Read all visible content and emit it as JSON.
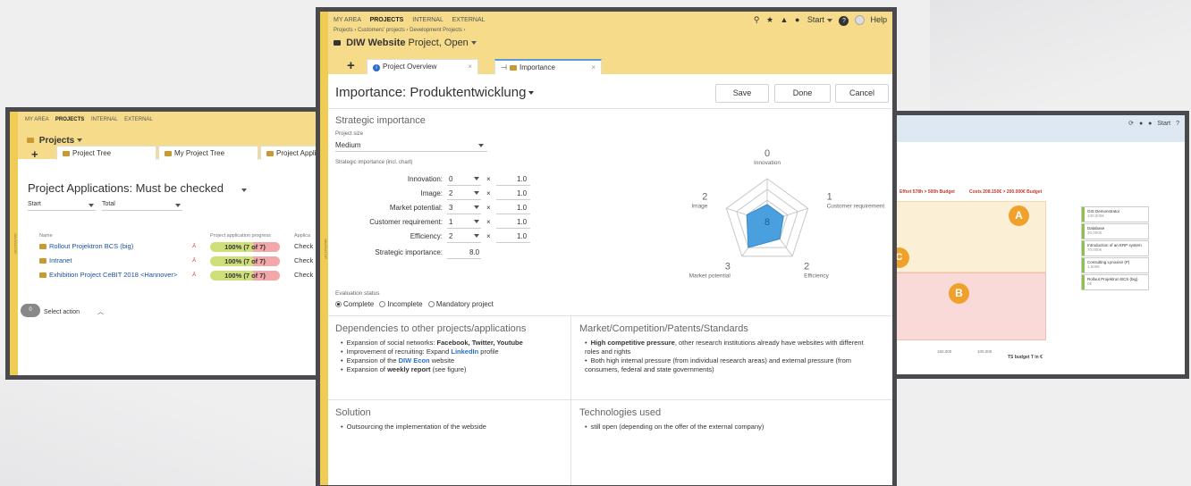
{
  "brand": "NAVIGATOR",
  "nav": {
    "my_area": "MY AREA",
    "projects": "PROJECTS",
    "internal": "INTERNAL",
    "external": "EXTERNAL"
  },
  "left": {
    "title": "Projects",
    "tabs": [
      "Project Tree",
      "My Project Tree",
      "Project Applica"
    ],
    "heading": "Project Applications: Must be checked",
    "filter_start": "Start",
    "filter_total": "Total",
    "columns": {
      "name": "Name",
      "progress": "Project application progress",
      "app": "Applica"
    },
    "rows": [
      {
        "name": "Rollout Projektron BCS (big)",
        "progress": "100% (7 of 7)",
        "action": "Check"
      },
      {
        "name": "Intranet",
        "progress": "100% (7 of 7)",
        "action": "Check"
      },
      {
        "name": "Exhibition Project CeBIT 2018 <Hannover>",
        "progress": "100% (7 of 7)",
        "action": "Check"
      }
    ],
    "select_count": "0",
    "select_action": "Select action"
  },
  "main": {
    "start": "Start",
    "help": "Help",
    "breadcrumb": "Projects  ›  Customers' projects  ›  Development Projects  ›",
    "project_name": "DIW Website",
    "project_state": "Project, Open",
    "tabs": [
      "Project Overview",
      "Importance"
    ],
    "page_title": "Importance: Produktentwicklung",
    "buttons": {
      "save": "Save",
      "done": "Done",
      "cancel": "Cancel"
    },
    "strategic": {
      "title": "Strategic importance",
      "size_label": "Project size",
      "size_value": "Medium",
      "chart_label": "Strategic importance (incl. chart)",
      "criteria": [
        {
          "label": "Innovation:",
          "value": "0",
          "weight": "1.0"
        },
        {
          "label": "Image:",
          "value": "2",
          "weight": "1.0"
        },
        {
          "label": "Market potential:",
          "value": "3",
          "weight": "1.0"
        },
        {
          "label": "Customer requirement:",
          "value": "1",
          "weight": "1.0"
        },
        {
          "label": "Efficiency:",
          "value": "2",
          "weight": "1.0"
        }
      ],
      "times": "×",
      "total_label": "Strategic importance:",
      "total_value": "8.0"
    },
    "radar": {
      "center_value": "8",
      "axes": [
        {
          "name": "Innovation",
          "value": "0"
        },
        {
          "name": "Customer requirement",
          "value": "1"
        },
        {
          "name": "Efficiency",
          "value": "2"
        },
        {
          "name": "Market potential",
          "value": "3"
        },
        {
          "name": "Image",
          "value": "2"
        }
      ],
      "color": "#4a9fdf"
    },
    "evaluation": {
      "label": "Evaluation status",
      "options": [
        "Complete",
        "Incomplete",
        "Mandatory project"
      ]
    },
    "dependencies": {
      "title": "Dependencies to other projects/applications",
      "items": [
        {
          "pre": "Expansion of social networks: ",
          "bold": "Facebook, Twitter, Youtube",
          "post": ""
        },
        {
          "pre": "Improvement of recruiting: Expand ",
          "link": "LinkedIn",
          "post": " profile"
        },
        {
          "pre": "Expansion of the ",
          "link": "DIW Econ",
          "post": " website"
        },
        {
          "pre": "Expansion of ",
          "bold": "weekly report",
          "post": " (see figure)"
        }
      ]
    },
    "market": {
      "title": "Market/Competition/Patents/Standards",
      "item1_bold": "High competitive pressure",
      "item1_rest": ", other research institutions already have websites with different roles and rights",
      "item2": "Both high internal pressure (from individual research areas) and external pressure (from consumers, federal and state governments)"
    },
    "solution": {
      "title": "Solution",
      "item": "Outsourcing the implementation of the webside"
    },
    "technologies": {
      "title": "Technologies used",
      "item": "still open (depending on the offer of the external company)"
    }
  },
  "right": {
    "start": "Start",
    "effort": "Effort 578h > 500h Budget",
    "costs": "Costs 208.150€ > 200.000€ Budget",
    "labels": [
      "A",
      "B",
      "C"
    ],
    "x_ticks": [
      "150,000",
      "100,000"
    ],
    "x_label": "TS budget T in €",
    "legend": [
      {
        "name": "GIS Demonstrator",
        "sub": "100,000€"
      },
      {
        "name": "Database",
        "sub": "30,000€"
      },
      {
        "name": "Introduction of an ERP system",
        "sub": "70,000€"
      },
      {
        "name": "Consulting Lynoxisir (P)",
        "sub": "1,500€"
      },
      {
        "name": "Rollout Projektron BCS (big)",
        "sub": "0€"
      }
    ],
    "colors": {
      "yellow": "#fbefd6",
      "pink": "#fad9d9",
      "orange": "#f0a12c",
      "green": "#8bc34a"
    }
  }
}
